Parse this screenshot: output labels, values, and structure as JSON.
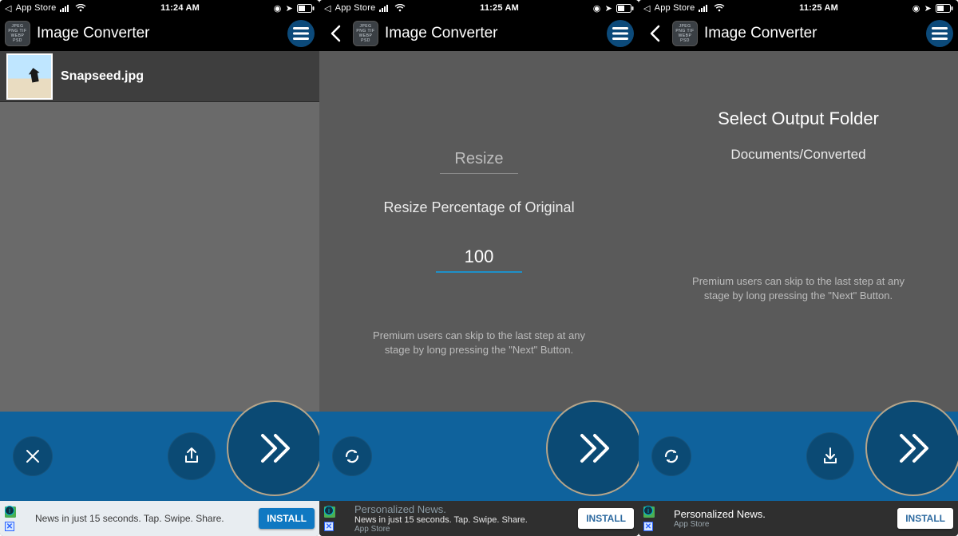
{
  "status": {
    "back_label": "App Store",
    "times": [
      "11:24 AM",
      "11:25 AM",
      "11:25 AM"
    ]
  },
  "nav": {
    "title": "Image Converter",
    "icon_lines": [
      "JPEG",
      "PNG TIF",
      "WEBP",
      "PSD"
    ]
  },
  "screen1": {
    "file_name": "Snapseed.jpg"
  },
  "screen2": {
    "resize_label": "Resize",
    "resize_desc": "Resize Percentage of Original",
    "resize_value": "100",
    "premium": "Premium users can skip to the last step at any stage by long pressing the \"Next\" Button."
  },
  "screen3": {
    "title": "Select Output Folder",
    "path": "Documents/Converted",
    "premium": "Premium users can skip to the last step at any stage by long pressing the \"Next\" Button."
  },
  "ad": {
    "headline": "Personalized News.",
    "sub": "App Store",
    "line_single": "News in just 15 seconds. Tap. Swipe. Share.",
    "install": "INSTALL"
  }
}
